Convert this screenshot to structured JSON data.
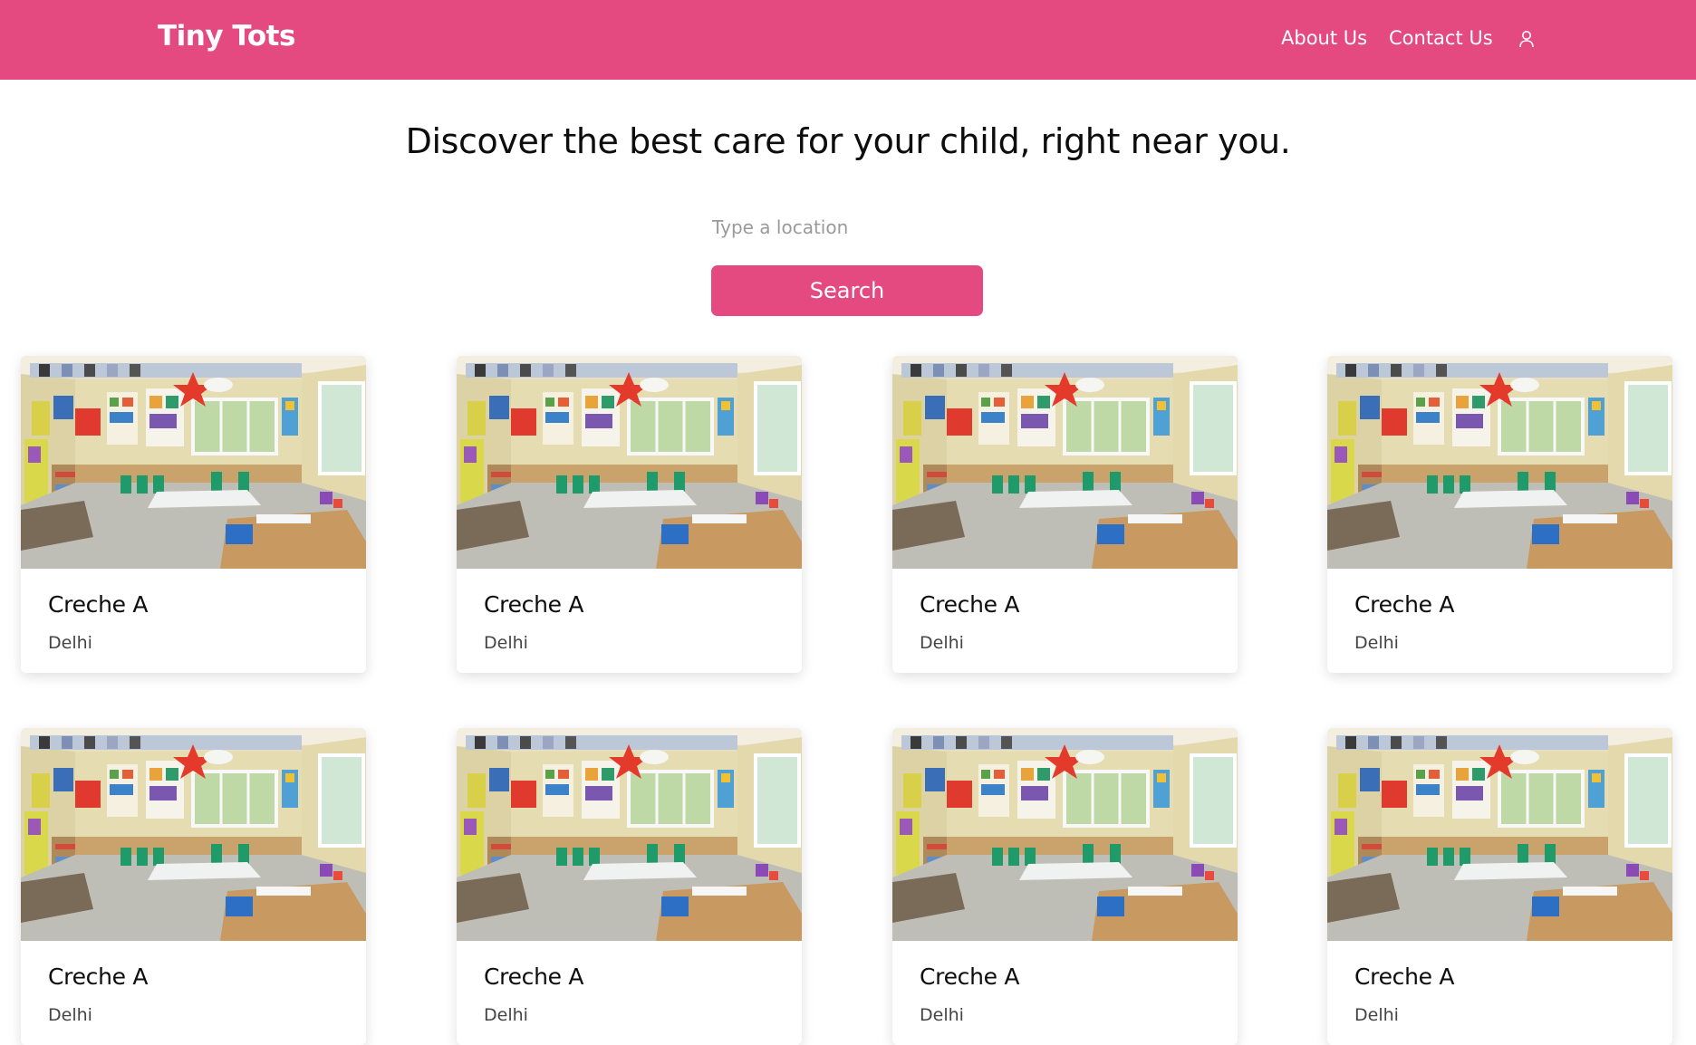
{
  "header": {
    "brand": "Tiny Tots",
    "nav": [
      {
        "label": "About Us"
      },
      {
        "label": "Contact Us"
      }
    ],
    "user_icon": "user-icon"
  },
  "hero": {
    "title": "Discover the best care for your child, right near you."
  },
  "search": {
    "placeholder": "Type a location",
    "value": "",
    "button_label": "Search"
  },
  "colors": {
    "brand": "#e44a80",
    "text": "#0d0d0d",
    "muted": "#9a9a9a"
  },
  "creches": [
    {
      "name": "Creche A",
      "location": "Delhi"
    },
    {
      "name": "Creche A",
      "location": "Delhi"
    },
    {
      "name": "Creche A",
      "location": "Delhi"
    },
    {
      "name": "Creche A",
      "location": "Delhi"
    },
    {
      "name": "Creche A",
      "location": "Delhi"
    },
    {
      "name": "Creche A",
      "location": "Delhi"
    },
    {
      "name": "Creche A",
      "location": "Delhi"
    },
    {
      "name": "Creche A",
      "location": "Delhi"
    }
  ]
}
